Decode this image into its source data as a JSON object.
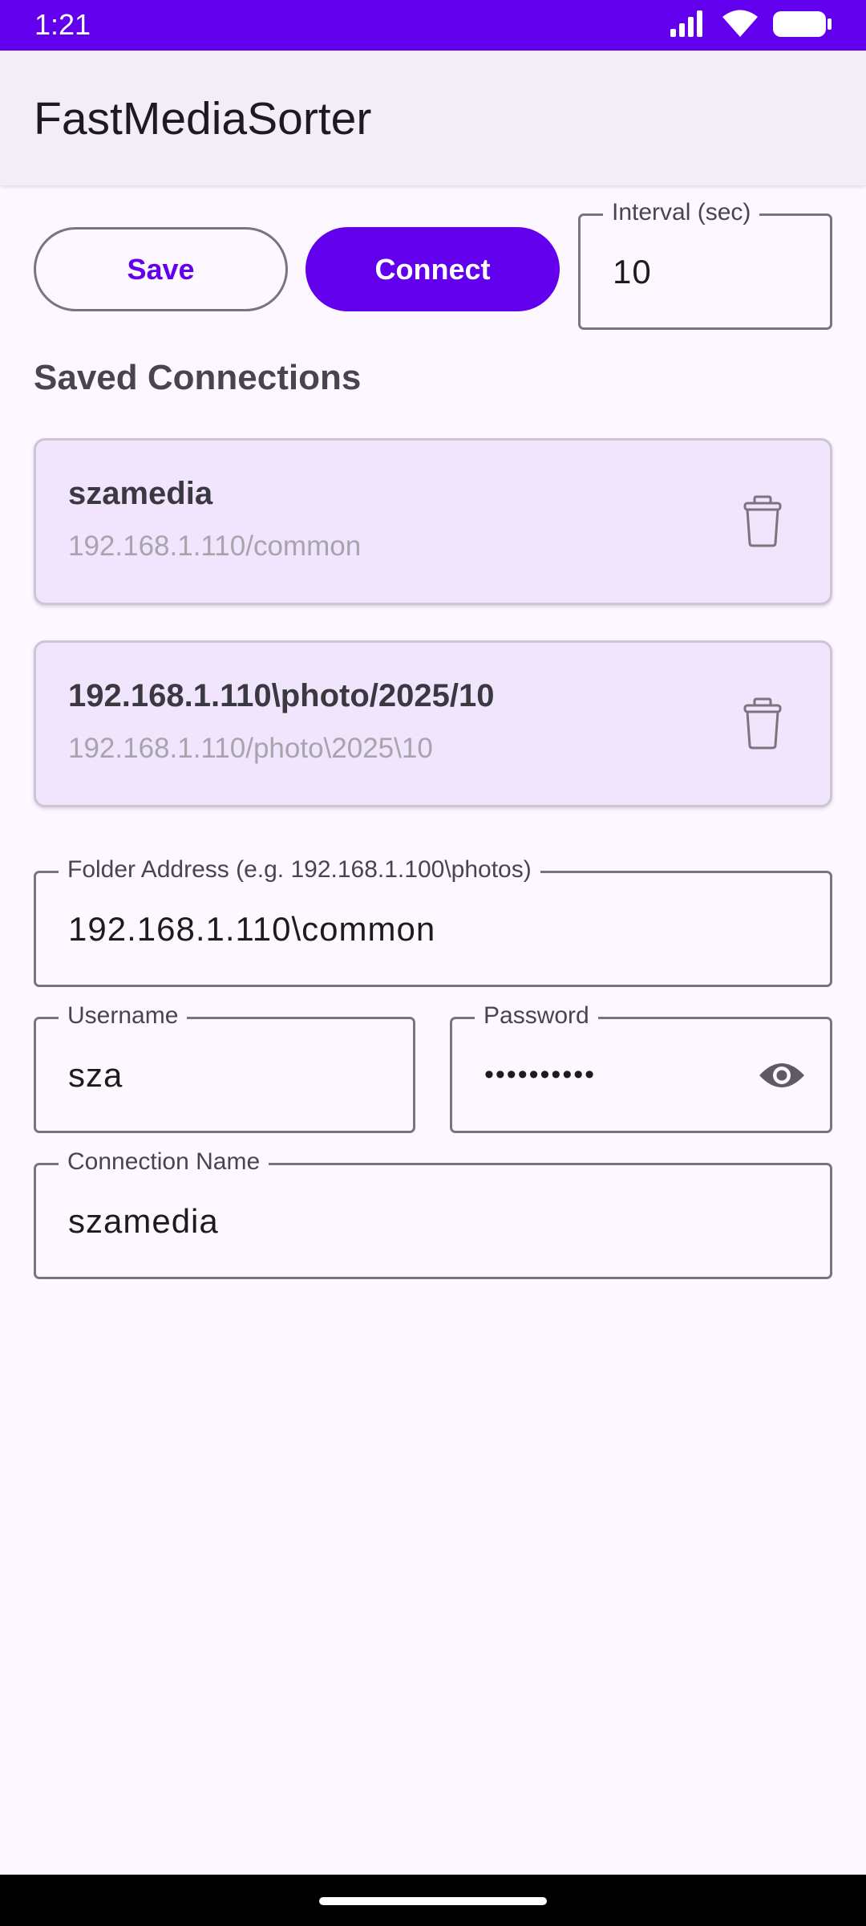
{
  "status_bar": {
    "time": "1:21",
    "icons": [
      "cellular-signal-icon",
      "wifi-icon",
      "battery-icon"
    ]
  },
  "app_bar": {
    "title": "FastMediaSorter"
  },
  "actions": {
    "save_label": "Save",
    "connect_label": "Connect"
  },
  "interval": {
    "label": "Interval (sec)",
    "value": "10"
  },
  "saved_connections": {
    "title": "Saved Connections",
    "items": [
      {
        "name": "szamedia",
        "path": "192.168.1.110/common",
        "delete_icon": "trash-icon"
      },
      {
        "name": "192.168.1.110\\photo/2025/10",
        "path": "192.168.1.110/photo\\2025\\10",
        "delete_icon": "trash-icon"
      }
    ]
  },
  "form": {
    "folder_address": {
      "label": "Folder Address (e.g. 192.168.1.100\\photos)",
      "value": "192.168.1.110\\common"
    },
    "username": {
      "label": "Username",
      "value": "sza"
    },
    "password": {
      "label": "Password",
      "value": "••••••••••",
      "toggle_icon": "eye-icon"
    },
    "connection_name": {
      "label": "Connection Name",
      "value": "szamedia"
    }
  },
  "colors": {
    "primary": "#6200ee",
    "background": "#fdf7ff",
    "app_bar": "#f3edf7",
    "card": "#f0e5fc",
    "outline": "#79747e"
  }
}
